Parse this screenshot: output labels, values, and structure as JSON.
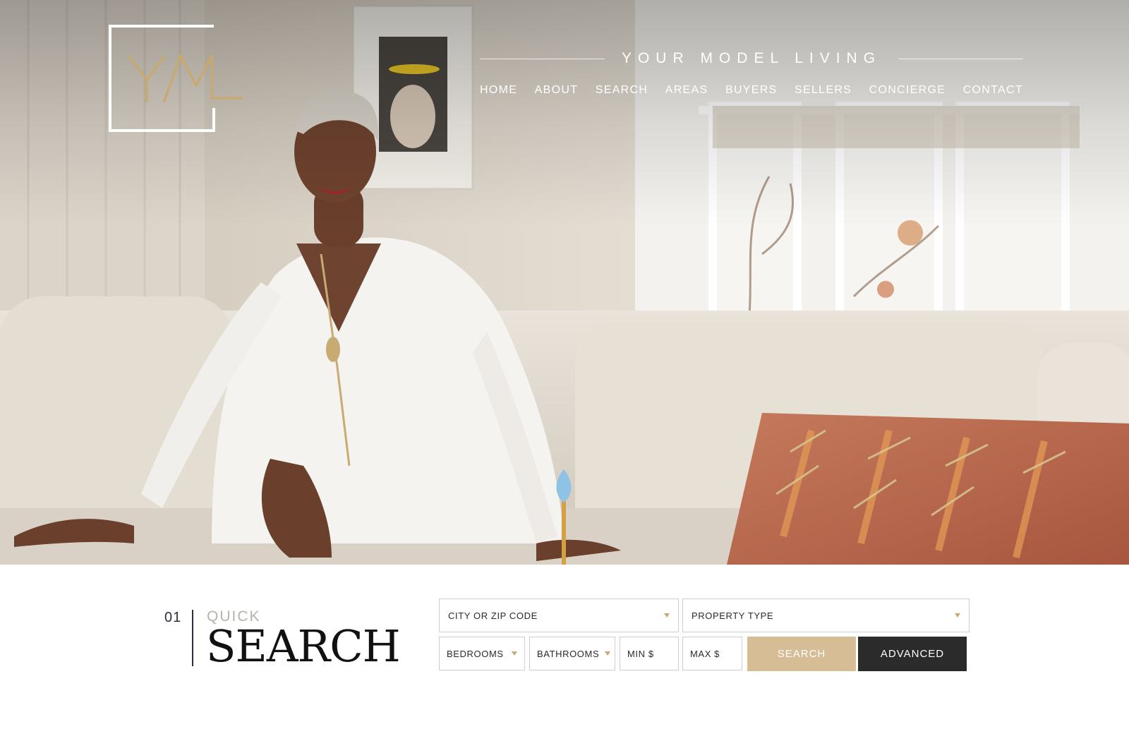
{
  "brand": {
    "name": "YOUR MODEL LIVING",
    "logo_text": "YML"
  },
  "nav": [
    "HOME",
    "ABOUT",
    "SEARCH",
    "AREAS",
    "BUYERS",
    "SELLERS",
    "CONCIERGE",
    "CONTACT"
  ],
  "quick_search": {
    "index": "01",
    "kicker": "QUICK",
    "title": "SEARCH",
    "location": "CITY OR ZIP CODE",
    "property_type": "PROPERTY TYPE",
    "bedrooms": "BEDROOMS",
    "bathrooms": "BATHROOMS",
    "min_price": "MIN $",
    "max_price": "MAX $",
    "search_button": "SEARCH",
    "advanced_button": "ADVANCED"
  },
  "colors": {
    "gold": "#c9a96e",
    "search_button": "#d7bd96",
    "advanced_button": "#2b2b2b",
    "text_dark": "#2d2f3e"
  },
  "icons": {
    "dropdown": "chevron-down-icon"
  }
}
